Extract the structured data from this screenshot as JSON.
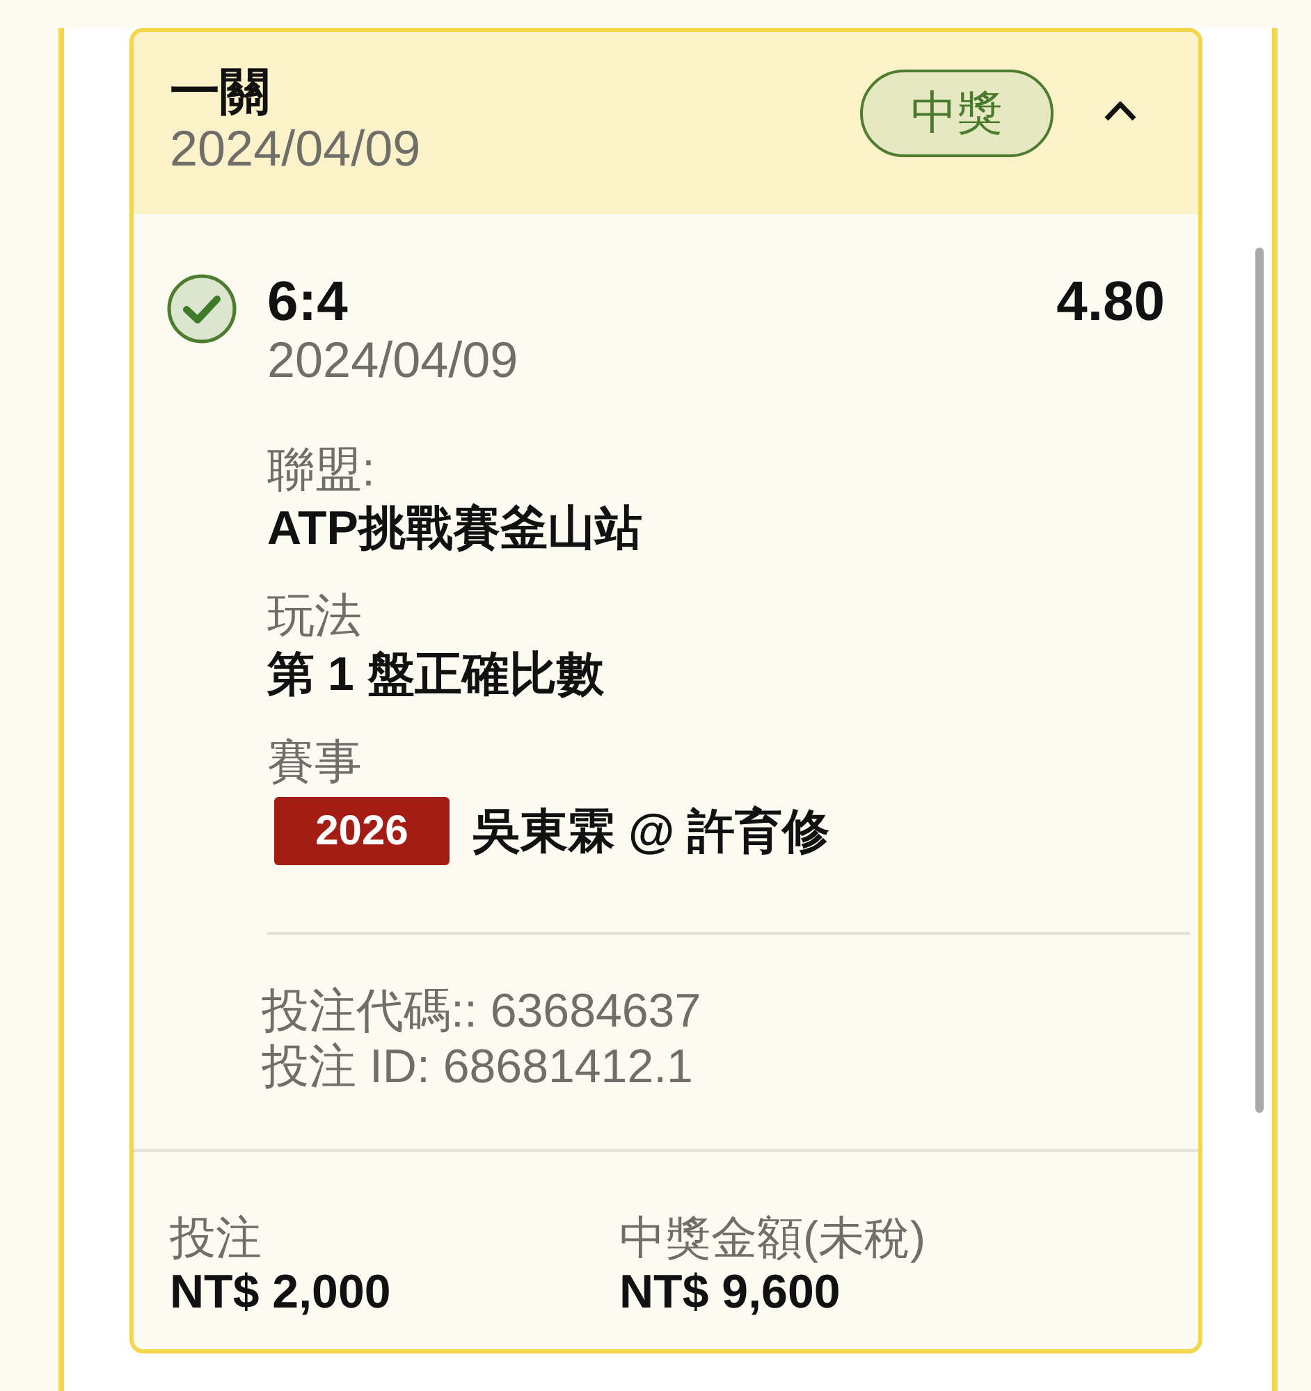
{
  "card": {
    "title": "一關",
    "date": "2024/04/09",
    "status": {
      "label": "中獎",
      "kind": "won"
    },
    "expanded": true,
    "selections": [
      {
        "won": true,
        "pick": "6:4",
        "odds": "4.80",
        "date": "2024/04/09",
        "details": [
          {
            "kind": "text",
            "label": "聯盟:",
            "value": "ATP挑戰賽釜山站"
          },
          {
            "kind": "text",
            "label": "玩法",
            "value": "第 1 盤正確比數"
          },
          {
            "kind": "event",
            "label": "賽事",
            "code": "2026",
            "value": "吳東霖 @ 許育修"
          }
        ],
        "bet_code": "投注代碼:: 63684637",
        "bet_id": "投注 ID: 68681412.1"
      }
    ],
    "amounts": [
      {
        "label": "投注",
        "value": "NT$ 2,000"
      },
      {
        "label": "中獎金額(未稅)",
        "value": "NT$ 9,600"
      }
    ]
  }
}
